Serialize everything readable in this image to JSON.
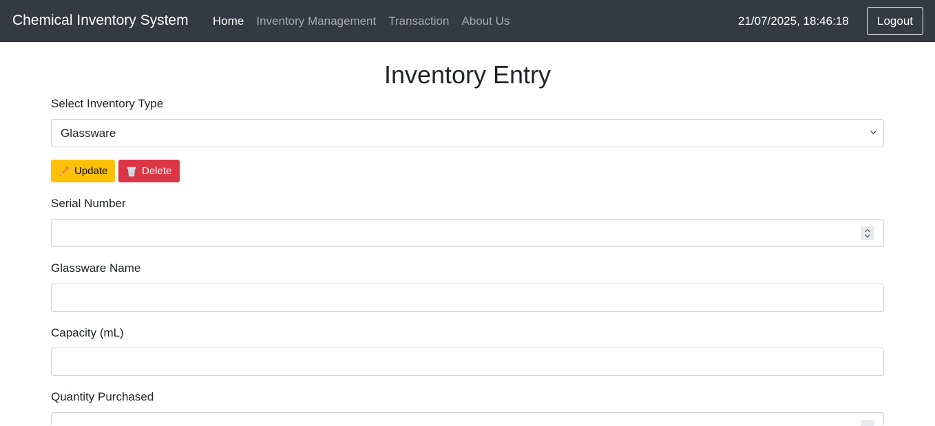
{
  "navbar": {
    "brand": "Chemical Inventory System",
    "links": [
      {
        "label": "Home",
        "active": true
      },
      {
        "label": "Inventory Management",
        "active": false
      },
      {
        "label": "Transaction",
        "active": false
      },
      {
        "label": "About Us",
        "active": false
      }
    ],
    "datetime": "21/07/2025, 18:46:18",
    "logout_label": "Logout"
  },
  "page": {
    "title": "Inventory Entry"
  },
  "form": {
    "inventory_type_label": "Select Inventory Type",
    "inventory_type_value": "Glassware",
    "update_label": "Update",
    "delete_label": "Delete",
    "serial_number_label": "Serial Number",
    "serial_number_value": "",
    "glassware_name_label": "Glassware Name",
    "glassware_name_value": "",
    "capacity_label": "Capacity (mL)",
    "capacity_value": "",
    "quantity_label": "Quantity Purchased",
    "quantity_value": ""
  },
  "icons": {
    "update": "pencil-icon",
    "delete": "wastebasket-icon",
    "select": "chevron-down-icon",
    "spinner": "spinner-arrows-icon"
  },
  "colors": {
    "navbar_bg": "#343a40",
    "update_btn": "#ffc107",
    "delete_btn": "#dc3545",
    "border": "#ced4da"
  }
}
